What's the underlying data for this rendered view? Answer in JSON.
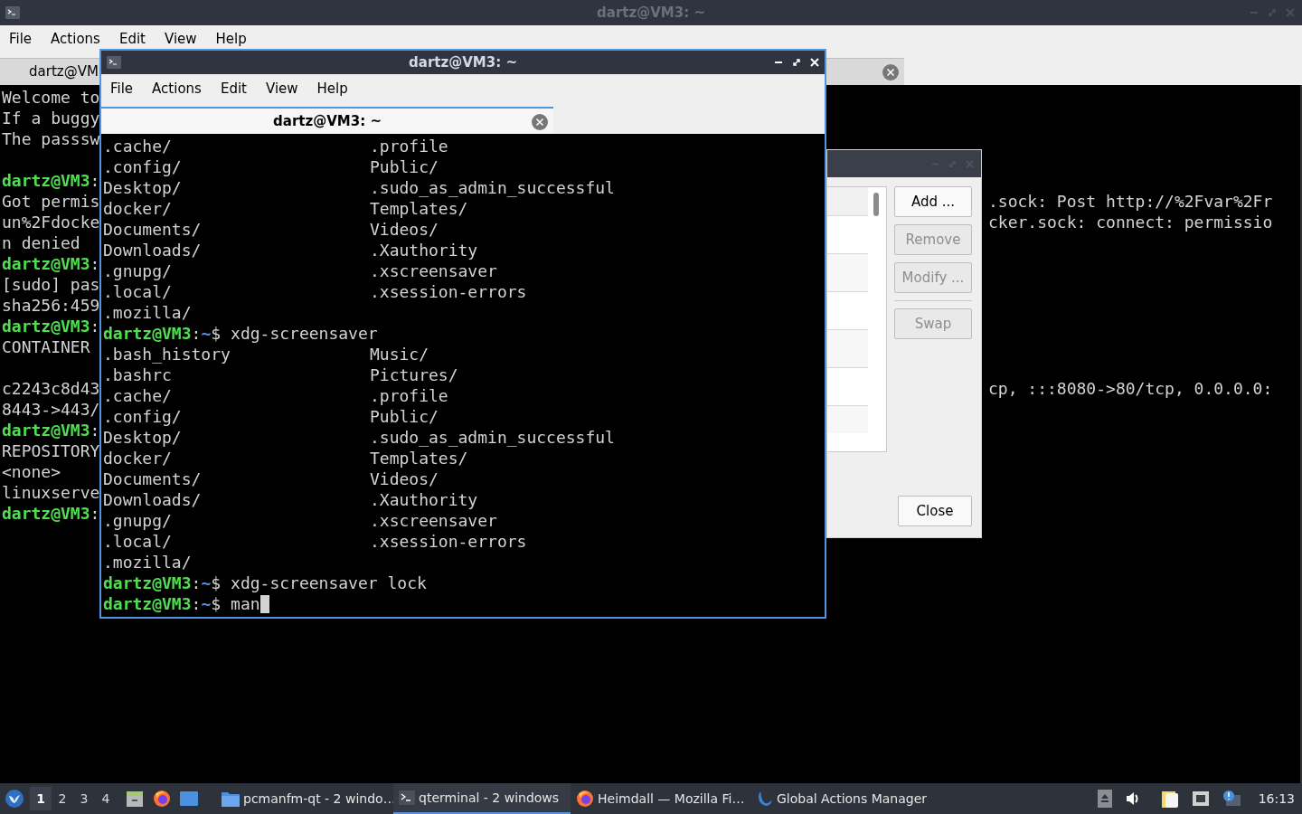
{
  "background_window": {
    "title": "dartz@VM3: ~",
    "menu": [
      "File",
      "Actions",
      "Edit",
      "View",
      "Help"
    ],
    "tab": {
      "label": "dartz@VM",
      "selected": true
    },
    "lines": [
      {
        "kind": "text",
        "text": "Welcome to"
      },
      {
        "kind": "text",
        "text": "If a buggy"
      },
      {
        "kind": "text",
        "text": "The passsw"
      },
      {
        "kind": "blank"
      },
      {
        "kind": "prompt",
        "user_host": "dartz@VM3",
        "colon": ":"
      },
      {
        "kind": "text",
        "text": "Got permis",
        "right": ".sock: Post http://%2Fvar%2Fr"
      },
      {
        "kind": "text",
        "text": "un%2Fdocke",
        "right": "cker.sock: connect: permissio"
      },
      {
        "kind": "text",
        "text": "n denied"
      },
      {
        "kind": "prompt",
        "user_host": "dartz@VM3",
        "colon": ":"
      },
      {
        "kind": "text",
        "text": "[sudo] pas"
      },
      {
        "kind": "text",
        "text": "sha256:459"
      },
      {
        "kind": "prompt",
        "user_host": "dartz@VM3",
        "colon": ":"
      },
      {
        "kind": "text",
        "text": "CONTAINER"
      },
      {
        "kind": "blank"
      },
      {
        "kind": "text",
        "text": "c2243c8d43",
        "right": "cp, :::8080->80/tcp, 0.0.0.0:"
      },
      {
        "kind": "text",
        "text": "8443->443/"
      },
      {
        "kind": "prompt",
        "user_host": "dartz@VM3",
        "colon": ":"
      },
      {
        "kind": "text",
        "text": "REPOSITORY"
      },
      {
        "kind": "text",
        "text": "<none>"
      },
      {
        "kind": "text",
        "text": "linuxserve"
      },
      {
        "kind": "prompt",
        "user_host": "dartz@VM3",
        "colon": ":"
      }
    ]
  },
  "dialog": {
    "buttons": [
      {
        "label": "Add ...",
        "disabled": false
      },
      {
        "label": "Remove",
        "disabled": true
      },
      {
        "label": "Modify ...",
        "disabled": true
      }
    ],
    "swap_button": {
      "label": "Swap",
      "disabled": true
    },
    "close_button": {
      "label": "Close",
      "disabled": false
    }
  },
  "front_window": {
    "title": "dartz@VM3: ~",
    "menu": [
      "File",
      "Actions",
      "Edit",
      "View",
      "Help"
    ],
    "tab": {
      "label": "dartz@VM3: ~",
      "selected": true
    },
    "lines": [
      {
        "kind": "listing",
        "left": ".cache/",
        "right": ".profile"
      },
      {
        "kind": "listing",
        "left": ".config/",
        "right": "Public/"
      },
      {
        "kind": "listing",
        "left": "Desktop/",
        "right": ".sudo_as_admin_successful"
      },
      {
        "kind": "listing",
        "left": "docker/",
        "right": "Templates/"
      },
      {
        "kind": "listing",
        "left": "Documents/",
        "right": "Videos/"
      },
      {
        "kind": "listing",
        "left": "Downloads/",
        "right": ".Xauthority"
      },
      {
        "kind": "listing",
        "left": ".gnupg/",
        "right": ".xscreensaver"
      },
      {
        "kind": "listing",
        "left": ".local/",
        "right": ".xsession-errors"
      },
      {
        "kind": "listing",
        "left": ".mozilla/"
      },
      {
        "kind": "prompt",
        "user_host": "dartz@VM3",
        "colon": ":",
        "path": "~",
        "sigil": "$",
        "command": "xdg-screensaver"
      },
      {
        "kind": "listing",
        "left": ".bash_history",
        "right": "Music/"
      },
      {
        "kind": "listing",
        "left": ".bashrc",
        "right": "Pictures/"
      },
      {
        "kind": "listing",
        "left": ".cache/",
        "right": ".profile"
      },
      {
        "kind": "listing",
        "left": ".config/",
        "right": "Public/"
      },
      {
        "kind": "listing",
        "left": "Desktop/",
        "right": ".sudo_as_admin_successful"
      },
      {
        "kind": "listing",
        "left": "docker/",
        "right": "Templates/"
      },
      {
        "kind": "listing",
        "left": "Documents/",
        "right": "Videos/"
      },
      {
        "kind": "listing",
        "left": "Downloads/",
        "right": ".Xauthority"
      },
      {
        "kind": "listing",
        "left": ".gnupg/",
        "right": ".xscreensaver"
      },
      {
        "kind": "listing",
        "left": ".local/",
        "right": ".xsession-errors"
      },
      {
        "kind": "listing",
        "left": ".mozilla/"
      },
      {
        "kind": "prompt",
        "user_host": "dartz@VM3",
        "colon": ":",
        "path": "~",
        "sigil": "$",
        "command": "xdg-screensaver lock"
      },
      {
        "kind": "prompt",
        "user_host": "dartz@VM3",
        "colon": ":",
        "path": "~",
        "sigil": "$",
        "command": "man",
        "cursor": true
      }
    ]
  },
  "taskbar": {
    "desktops": [
      {
        "label": "1",
        "selected": true
      },
      {
        "label": "2",
        "selected": false
      },
      {
        "label": "3",
        "selected": false
      },
      {
        "label": "4",
        "selected": false
      }
    ],
    "tasks": [
      {
        "kind": "folder",
        "label": "pcmanfm-qt - 2 windo…",
        "selected": false
      },
      {
        "kind": "terminal",
        "label": "qterminal - 2 windows",
        "selected": true
      },
      {
        "kind": "browser",
        "label": "Heimdall — Mozilla Fi…",
        "selected": false
      },
      {
        "kind": "swirl",
        "label": "Global Actions Manager",
        "selected": false
      }
    ],
    "clock": "16:13"
  }
}
